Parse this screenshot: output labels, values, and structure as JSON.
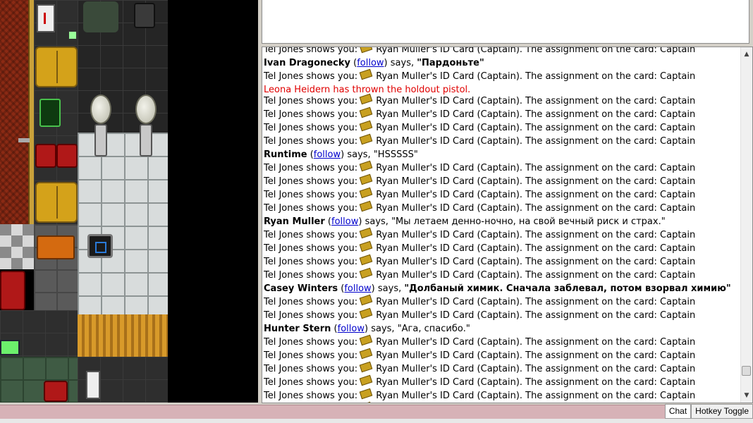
{
  "chat": {
    "lines": [
      {
        "kind": "card",
        "actor": "Tel Jones shows you:",
        "item": "Ryan Muller's ID Card (Captain). The assignment on the card: Captain"
      },
      {
        "kind": "say",
        "speaker": "Ivan Dragonecky",
        "follow": "follow",
        "verb": "says,",
        "quote": "\"Пардоньте\"",
        "bold": true
      },
      {
        "kind": "card",
        "actor": "Tel Jones shows you:",
        "item": "Ryan Muller's ID Card (Captain). The assignment on the card: Captain"
      },
      {
        "kind": "alert",
        "text": "Leona Heidern has thrown the holdout pistol."
      },
      {
        "kind": "card",
        "actor": "Tel Jones shows you:",
        "item": "Ryan Muller's ID Card (Captain). The assignment on the card: Captain"
      },
      {
        "kind": "card",
        "actor": "Tel Jones shows you:",
        "item": "Ryan Muller's ID Card (Captain). The assignment on the card: Captain"
      },
      {
        "kind": "card",
        "actor": "Tel Jones shows you:",
        "item": "Ryan Muller's ID Card (Captain). The assignment on the card: Captain"
      },
      {
        "kind": "card",
        "actor": "Tel Jones shows you:",
        "item": "Ryan Muller's ID Card (Captain). The assignment on the card: Captain"
      },
      {
        "kind": "say",
        "speaker": "Runtime",
        "follow": "follow",
        "verb": "says,",
        "quote": "\"HSSSSS\"",
        "bold": false
      },
      {
        "kind": "card",
        "actor": "Tel Jones shows you:",
        "item": "Ryan Muller's ID Card (Captain). The assignment on the card: Captain"
      },
      {
        "kind": "card",
        "actor": "Tel Jones shows you:",
        "item": "Ryan Muller's ID Card (Captain). The assignment on the card: Captain"
      },
      {
        "kind": "card",
        "actor": "Tel Jones shows you:",
        "item": "Ryan Muller's ID Card (Captain). The assignment on the card: Captain"
      },
      {
        "kind": "card",
        "actor": "Tel Jones shows you:",
        "item": "Ryan Muller's ID Card (Captain). The assignment on the card: Captain"
      },
      {
        "kind": "say",
        "speaker": "Ryan Muller",
        "follow": "follow",
        "verb": "says,",
        "quote": "\"Мы летаем денно-ночно, на свой вечный риск и страх.\"",
        "bold": false
      },
      {
        "kind": "card",
        "actor": "Tel Jones shows you:",
        "item": "Ryan Muller's ID Card (Captain). The assignment on the card: Captain"
      },
      {
        "kind": "card",
        "actor": "Tel Jones shows you:",
        "item": "Ryan Muller's ID Card (Captain). The assignment on the card: Captain"
      },
      {
        "kind": "card",
        "actor": "Tel Jones shows you:",
        "item": "Ryan Muller's ID Card (Captain). The assignment on the card: Captain"
      },
      {
        "kind": "card",
        "actor": "Tel Jones shows you:",
        "item": "Ryan Muller's ID Card (Captain). The assignment on the card: Captain"
      },
      {
        "kind": "say",
        "speaker": "Casey Winters",
        "follow": "follow",
        "verb": "says,",
        "quote": "\"Долбаный химик. Сначала заблевал, потом взорвал химию\"",
        "bold": true
      },
      {
        "kind": "card",
        "actor": "Tel Jones shows you:",
        "item": "Ryan Muller's ID Card (Captain). The assignment on the card: Captain"
      },
      {
        "kind": "card",
        "actor": "Tel Jones shows you:",
        "item": "Ryan Muller's ID Card (Captain). The assignment on the card: Captain"
      },
      {
        "kind": "say",
        "speaker": "Hunter Stern",
        "follow": "follow",
        "verb": "says,",
        "quote": "\"Ага, спасибо.\"",
        "bold": false
      },
      {
        "kind": "card",
        "actor": "Tel Jones shows you:",
        "item": "Ryan Muller's ID Card (Captain). The assignment on the card: Captain"
      },
      {
        "kind": "card",
        "actor": "Tel Jones shows you:",
        "item": "Ryan Muller's ID Card (Captain). The assignment on the card: Captain"
      },
      {
        "kind": "card",
        "actor": "Tel Jones shows you:",
        "item": "Ryan Muller's ID Card (Captain). The assignment on the card: Captain"
      },
      {
        "kind": "card",
        "actor": "Tel Jones shows you:",
        "item": "Ryan Muller's ID Card (Captain). The assignment on the card: Captain"
      },
      {
        "kind": "card",
        "actor": "Tel Jones shows you:",
        "item": "Ryan Muller's ID Card (Captain). The assignment on the card: Captain"
      },
      {
        "kind": "card",
        "actor": "Tel Jones shows you:",
        "item": "Ryan Muller's ID Card (Captain). The assignment on the card: Captain"
      }
    ]
  },
  "tabs": {
    "chat_label": "Chat",
    "hotkey_label": "Hotkey Toggle"
  },
  "colors": {
    "alert": "#e00000",
    "link": "#0000cc",
    "bottom_bar": "#d7b2b7"
  },
  "icons": {
    "card": "id-card-icon"
  }
}
